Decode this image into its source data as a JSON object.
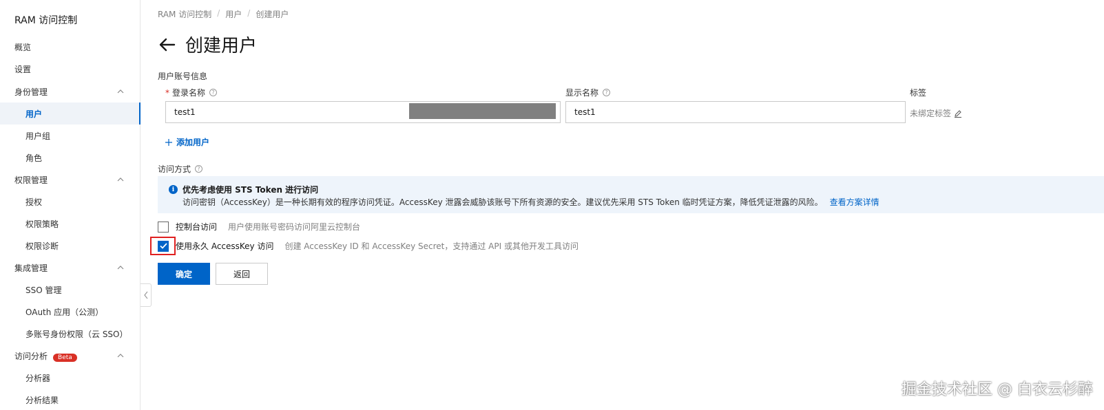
{
  "sidebar": {
    "title": "RAM 访问控制",
    "items": [
      {
        "label": "概览"
      },
      {
        "label": "设置"
      },
      {
        "label": "身份管理"
      },
      {
        "label": "用户"
      },
      {
        "label": "用户组"
      },
      {
        "label": "角色"
      },
      {
        "label": "权限管理"
      },
      {
        "label": "授权"
      },
      {
        "label": "权限策略"
      },
      {
        "label": "权限诊断"
      },
      {
        "label": "集成管理"
      },
      {
        "label": "SSO 管理"
      },
      {
        "label": "OAuth 应用（公测）"
      },
      {
        "label": "多账号身份权限（云 SSO）"
      },
      {
        "label": "访问分析",
        "badge": "Beta"
      },
      {
        "label": "分析器"
      },
      {
        "label": "分析结果"
      }
    ]
  },
  "breadcrumb": [
    "RAM 访问控制",
    "用户",
    "创建用户"
  ],
  "page": {
    "title": "创建用户",
    "account_section": "用户账号信息",
    "login_label": "登录名称",
    "display_label": "显示名称",
    "tag_label": "标签",
    "login_value": "test1",
    "display_value": "test1",
    "tag_value": "未绑定标签",
    "add_user": "添加用户",
    "access_section": "访问方式"
  },
  "alert": {
    "title": "优先考虑使用 STS Token 进行访问",
    "body": "访问密钥（AccessKey）是一种长期有效的程序访问凭证。AccessKey 泄露会威胁该账号下所有资源的安全。建议优先采用 STS Token 临时凭证方案，降低凭证泄露的风险。",
    "link": "查看方案详情"
  },
  "access": {
    "console_label": "控制台访问",
    "console_desc": "用户使用账号密码访问阿里云控制台",
    "console_checked": false,
    "ak_label": "使用永久 AccessKey 访问",
    "ak_desc": "创建 AccessKey ID 和 AccessKey Secret，支持通过 API 或其他开发工具访问",
    "ak_checked": true
  },
  "buttons": {
    "confirm": "确定",
    "back": "返回"
  },
  "watermark": "掘金技术社区 @ 白衣云杉醉",
  "colors": {
    "primary": "#0064c8",
    "danger": "#d93026",
    "highlight": "#e02020"
  }
}
